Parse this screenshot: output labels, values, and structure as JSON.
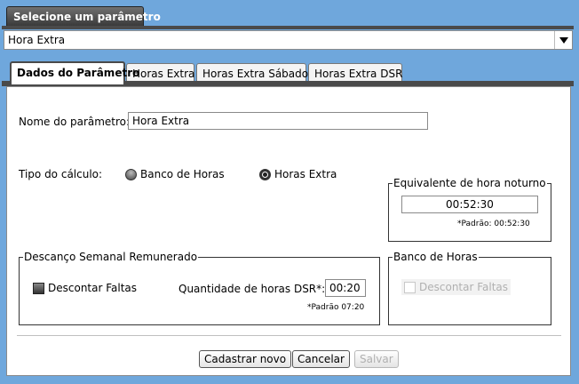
{
  "header": {
    "title_tab": "Selecione um parâmetro"
  },
  "parameter_select": {
    "value": "Hora Extra"
  },
  "tabs": [
    {
      "label": "Dados do Parâmetro",
      "active": true
    },
    {
      "label": "Horas Extra"
    },
    {
      "label": "Horas Extra Sábado"
    },
    {
      "label": "Horas Extra DSR"
    }
  ],
  "form": {
    "nome_label": "Nome do parâmetro:",
    "nome_value": "Hora Extra",
    "tipo_label": "Tipo do cálculo:",
    "radio_banco": "Banco de Horas",
    "radio_horas": "Horas Extra",
    "selected_tipo": "Horas Extra"
  },
  "noturno": {
    "legend": "Equivalente de hora noturno",
    "value": "00:52:30",
    "hint": "*Padrão: 00:52:30"
  },
  "dsr": {
    "legend": "Descanço Semanal Remunerado",
    "checkbox_label": "Descontar Faltas",
    "qtd_label": "Quantidade de horas DSR*:",
    "qtd_value": "00:20",
    "hint": "*Padrão 07:20"
  },
  "banco": {
    "legend": "Banco de Horas",
    "checkbox_label": "Descontar Faltas"
  },
  "buttons": {
    "cadastrar": "Cadastrar novo",
    "cancelar": "Cancelar",
    "salvar": "Salvar"
  }
}
